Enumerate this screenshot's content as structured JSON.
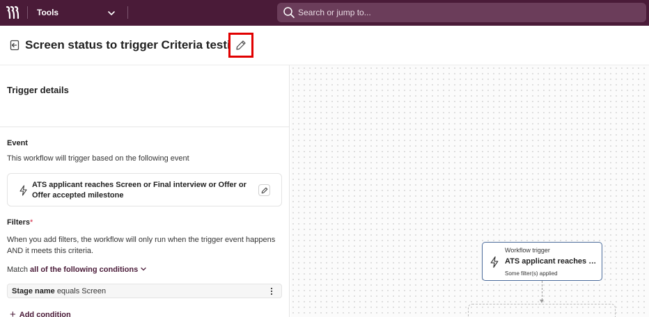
{
  "topbar": {
    "app_label": "Tools",
    "search_placeholder": "Search or jump to..."
  },
  "header": {
    "title": "Screen status to trigger Criteria testing"
  },
  "panel": {
    "heading": "Trigger details",
    "event": {
      "label": "Event",
      "description": "This workflow will trigger based on the following event",
      "card_text": "ATS applicant reaches Screen or Final interview or Offer or Offer accepted milestone"
    },
    "filters": {
      "label": "Filters",
      "required_mark": "*",
      "description": "When you add filters, the workflow will only run when the trigger event happens AND it meets this criteria.",
      "match_prefix": "Match",
      "match_mode": "all of the following conditions",
      "conditions": [
        {
          "field": "Stage name",
          "rest": "equals Screen"
        }
      ],
      "add_label": "Add condition"
    }
  },
  "canvas": {
    "trigger_node": {
      "type_label": "Workflow trigger",
      "title": "ATS applicant reaches Screen or Final interview or Offer or Offer accepted milestone",
      "subtitle": "Some filter(s) applied"
    }
  },
  "colors": {
    "brand": "#4a1b38",
    "highlight": "#e10000",
    "node_border": "#4a6a9a"
  }
}
